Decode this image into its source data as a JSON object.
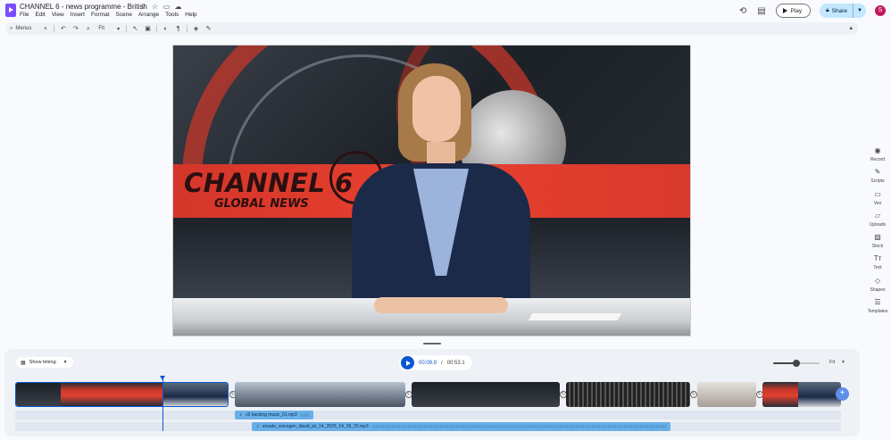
{
  "app": {
    "title": "CHANNEL 6 - news programme - British",
    "menu": [
      "File",
      "Edit",
      "View",
      "Insert",
      "Format",
      "Scene",
      "Arrange",
      "Tools",
      "Help"
    ]
  },
  "header": {
    "play_label": "Play",
    "share_label": "Share",
    "avatar_initial": "S"
  },
  "toolbar": {
    "search_label": "Menus",
    "zoom_label": "Fit"
  },
  "canvas": {
    "logo_main": "CHANNEL",
    "logo_number": "6",
    "logo_sub": "GLOBAL NEWS"
  },
  "sidebar": {
    "items": [
      {
        "label": "Record",
        "icon": "record-icon"
      },
      {
        "label": "Scripts",
        "icon": "scripts-icon"
      },
      {
        "label": "Veo",
        "icon": "veo-icon"
      },
      {
        "label": "Uploads",
        "icon": "uploads-icon"
      },
      {
        "label": "Stock",
        "icon": "stock-icon"
      },
      {
        "label": "Text",
        "icon": "text-icon"
      },
      {
        "label": "Shapes",
        "icon": "shapes-icon"
      },
      {
        "label": "Templates",
        "icon": "templates-icon"
      }
    ]
  },
  "timeline": {
    "show_timing_label": "Show timing",
    "current_time": "00:09.9",
    "separator": "/",
    "total_time": "00:53.1",
    "zoom_label": "Fit",
    "zoom_level": 0.5,
    "audio_tracks": [
      {
        "name": "c6 backing music_01.mp3"
      },
      {
        "name": "envato_voicegen_david_jul_14_2025_14_26_25.mp3"
      }
    ]
  },
  "colors": {
    "accent": "#0b57d0",
    "share_bg": "#c2e7ff",
    "audio_clip": "#6ab0e8",
    "brand_red": "#e8402f"
  }
}
